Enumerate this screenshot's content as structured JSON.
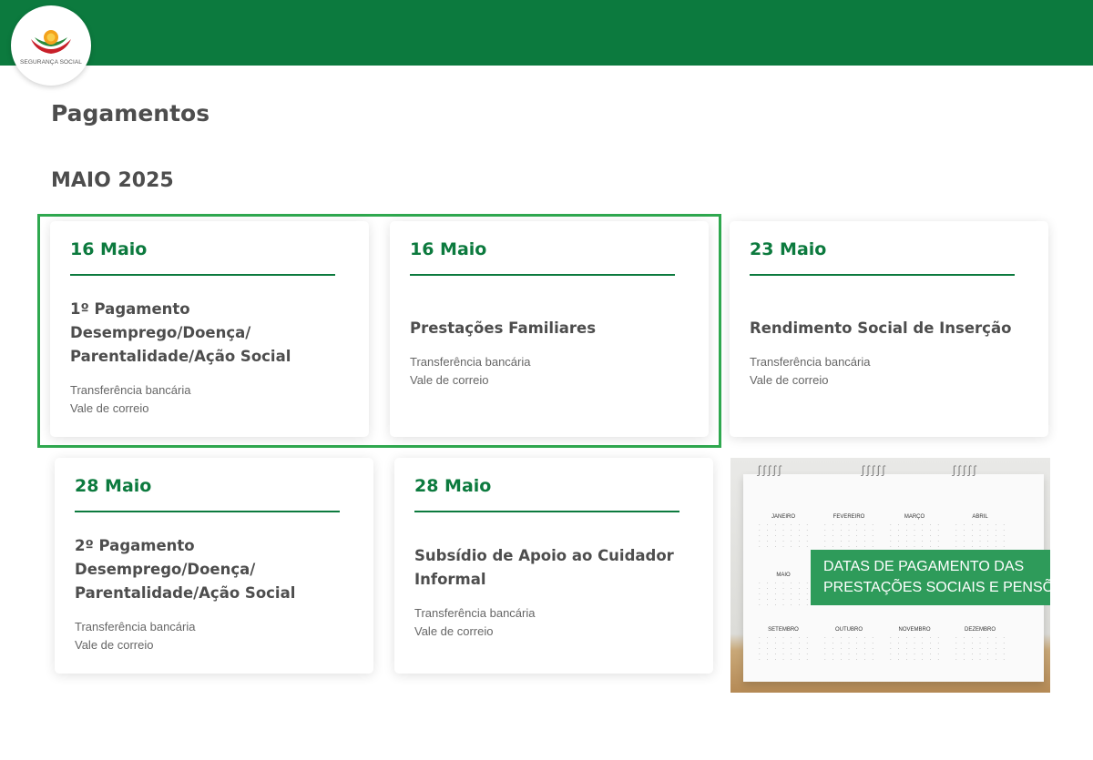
{
  "header": {
    "logo_text": "SEGURANÇA SOCIAL"
  },
  "page_title": "Pagamentos",
  "month_title": "MAIO 2025",
  "cards": [
    {
      "date": "16 Maio",
      "title": "1º Pagamento Desemprego/Doença/ Parentalidade/Ação Social",
      "methods": [
        "Transferência bancária",
        "Vale de correio"
      ]
    },
    {
      "date": "16 Maio",
      "title": "Prestações Familiares",
      "methods": [
        "Transferência bancária",
        "Vale de correio"
      ]
    },
    {
      "date": "23 Maio",
      "title": "Rendimento Social de Inserção",
      "methods": [
        "Transferência bancária",
        "Vale de correio"
      ]
    },
    {
      "date": "28 Maio",
      "title": "2º Pagamento Desemprego/Doença/ Parentalidade/Ação Social",
      "methods": [
        "Transferência bancária",
        "Vale de correio"
      ]
    },
    {
      "date": "28 Maio",
      "title": "Subsídio de Apoio ao Cuidador Informal",
      "methods": [
        "Transferência bancária",
        "Vale de correio"
      ]
    }
  ],
  "promo": {
    "banner_line1": "DATAS DE PAGAMENTO DAS",
    "banner_line2": "PRESTAÇÕES SOCIAIS E PENSÕES",
    "calendar_months": [
      "JANEIRO",
      "FEVEREIRO",
      "MARÇO",
      "ABRIL",
      "MAIO",
      "SETEMBRO",
      "OUTUBRO",
      "NOVEMBRO",
      "DEZEMBRO"
    ]
  },
  "colors": {
    "brand_green": "#0c7a3e",
    "highlight_green": "#2fa84f",
    "banner_green": "#2e9b5a"
  }
}
